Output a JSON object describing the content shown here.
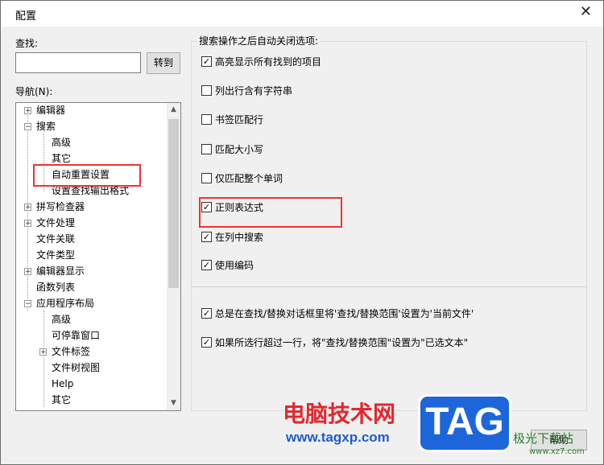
{
  "window": {
    "title": "配置",
    "close_glyph": "✕"
  },
  "find": {
    "label": "查找:",
    "value": "",
    "goto_label": "转到"
  },
  "nav": {
    "label": "导航(N):",
    "tree": [
      {
        "label": "编辑器",
        "expander": "+"
      },
      {
        "label": "搜索",
        "expander": "−"
      },
      {
        "label": "高级"
      },
      {
        "label": "其它"
      },
      {
        "label": "自动重置设置"
      },
      {
        "label": "设置查找输出格式"
      },
      {
        "label": "拼写检查器",
        "expander": "+"
      },
      {
        "label": "文件处理",
        "expander": "+"
      },
      {
        "label": "文件关联"
      },
      {
        "label": "文件类型"
      },
      {
        "label": "编辑器显示",
        "expander": "+"
      },
      {
        "label": "函数列表"
      },
      {
        "label": "应用程序布局",
        "expander": "−"
      },
      {
        "label": "高级"
      },
      {
        "label": "可停靠窗口"
      },
      {
        "label": "文件标签",
        "expander": "+"
      },
      {
        "label": "文件树视图"
      },
      {
        "label": "Help"
      },
      {
        "label": "其它"
      }
    ]
  },
  "options": {
    "group_title": "搜索操作之后自动关闭选项:",
    "items": [
      {
        "label": "高亮显示所有找到的项目",
        "checked": true
      },
      {
        "label": "列出行含有字符串",
        "checked": false
      },
      {
        "label": "书签匹配行",
        "checked": false
      },
      {
        "label": "匹配大小写",
        "checked": false
      },
      {
        "label": "仅匹配整个单词",
        "checked": false
      },
      {
        "label": "正则表达式",
        "checked": true
      },
      {
        "label": "在列中搜索",
        "checked": true
      },
      {
        "label": "使用编码",
        "checked": true
      }
    ],
    "extra": [
      {
        "label": "总是在查找/替换对话框里将'查找/替换范围'设置为'当前文件'",
        "checked": true
      },
      {
        "label": "如果所选行超过一行，将\"查找/替换范围\"设置为\"已选文本\"",
        "checked": true
      }
    ]
  },
  "help": {
    "label": "帮助"
  },
  "colors": {
    "highlight": "#e33333",
    "watermark_red": "#e6262e",
    "watermark_blue": "#1d66d9"
  },
  "watermark": {
    "text": "电脑技术网",
    "url": "www.tagxp.com",
    "logo": "TAG",
    "site": "极光下载站",
    "site_url": "www.xz7.com"
  }
}
